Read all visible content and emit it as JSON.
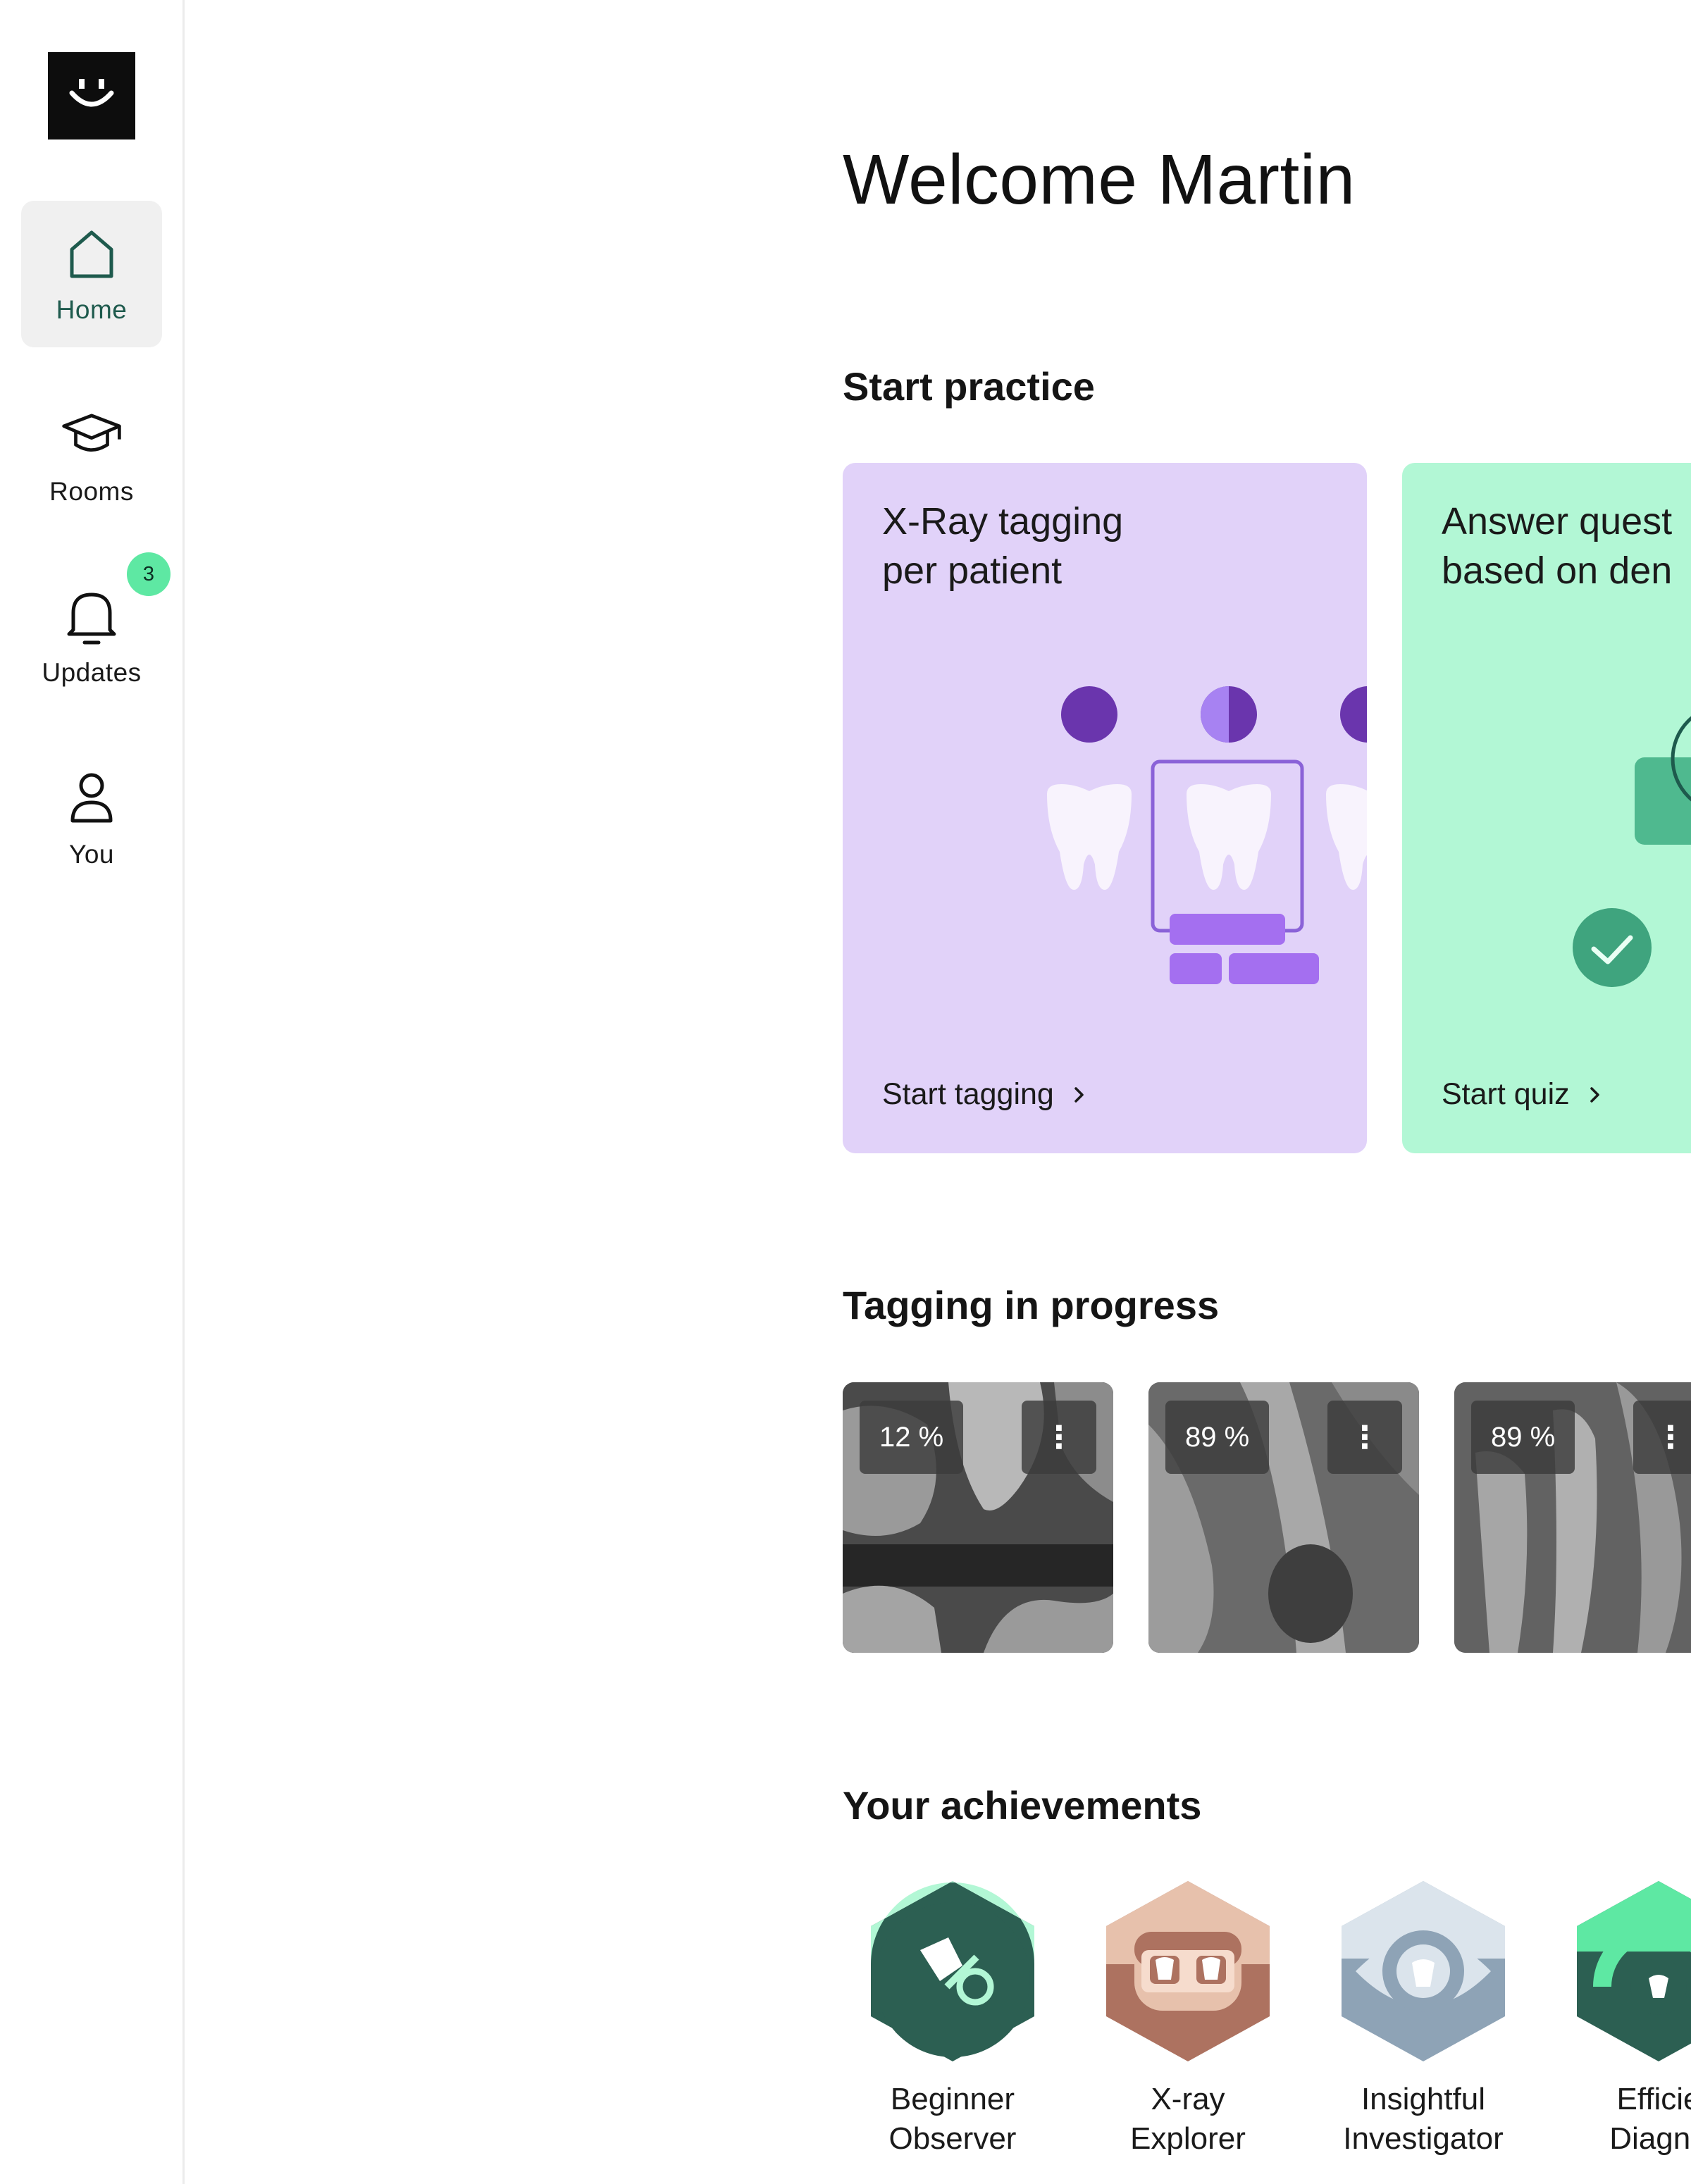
{
  "sidebar": {
    "logo_icon": "smiley-logo-icon",
    "items": [
      {
        "label": "Home",
        "icon": "home-icon",
        "active": true
      },
      {
        "label": "Rooms",
        "icon": "graduation-cap-icon"
      },
      {
        "label": "Updates",
        "icon": "bell-icon",
        "badge": "3"
      },
      {
        "label": "You",
        "icon": "user-icon"
      }
    ]
  },
  "main": {
    "welcome": "Welcome Martin",
    "start_practice": {
      "heading": "Start practice",
      "cards": [
        {
          "title": "X-Ray tagging\nper patient",
          "action": "Start tagging",
          "color": "#e1d2f9"
        },
        {
          "title": "Answer quest\nbased on den",
          "action": "Start quiz",
          "color": "#b2f7d5"
        }
      ]
    },
    "tagging": {
      "heading": "Tagging in progress",
      "items": [
        {
          "progress": "12 %"
        },
        {
          "progress": "89 %"
        },
        {
          "progress": "89 %"
        }
      ]
    },
    "achievements": {
      "heading": "Your achievements",
      "items": [
        {
          "label": "Beginner\nObserver",
          "icon": "tooth-percent-badge-icon"
        },
        {
          "label": "X-ray\nExplorer",
          "icon": "xray-teeth-badge-icon"
        },
        {
          "label": "Insightful\nInvestigator",
          "icon": "eye-tooth-badge-icon"
        },
        {
          "label": "Efficie\nDiagno",
          "icon": "gauge-tooth-badge-icon"
        }
      ]
    }
  },
  "colors": {
    "accent_green": "#5ee8a3",
    "active_label": "#1e5a4d",
    "purple_card": "#e1d2f9",
    "green_card": "#b2f7d5"
  }
}
